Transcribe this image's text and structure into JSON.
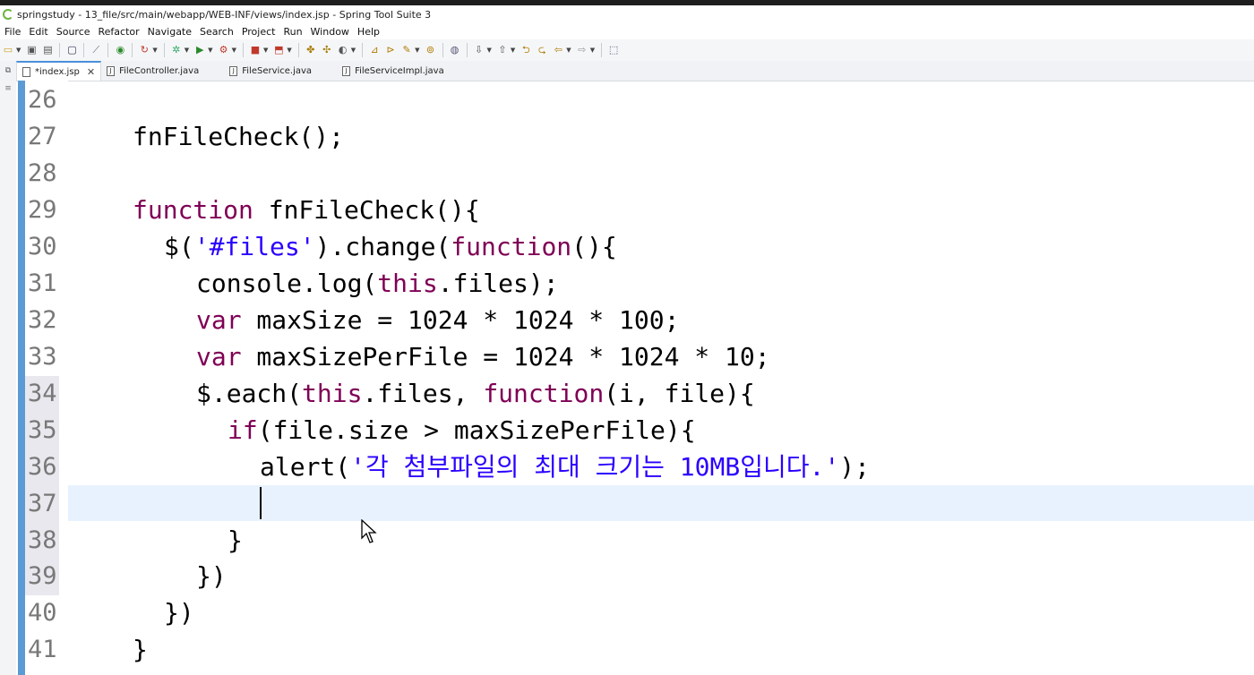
{
  "window": {
    "title": "springstudy - 13_file/src/main/webapp/WEB-INF/views/index.jsp - Spring Tool Suite 3"
  },
  "menu": [
    "File",
    "Edit",
    "Source",
    "Refactor",
    "Navigate",
    "Search",
    "Project",
    "Run",
    "Window",
    "Help"
  ],
  "tabs": [
    {
      "label": "*index.jsp",
      "active": true
    },
    {
      "label": "FileController.java",
      "active": false
    },
    {
      "label": "FileService.java",
      "active": false
    },
    {
      "label": "FileServiceImpl.java",
      "active": false
    }
  ],
  "editor": {
    "line_numbers": [
      "26",
      "27",
      "28",
      "29",
      "30",
      "31",
      "32",
      "33",
      "34",
      "35",
      "36",
      "37",
      "38",
      "39",
      "40",
      "41"
    ],
    "lines": {
      "l27": {
        "name": "fnFileCheck();"
      },
      "l29": {
        "kw": "function",
        "rest": " fnFileCheck(){"
      },
      "l30": {
        "a": "$(",
        "str": "'#files'",
        "b": ").change(",
        "kw": "function",
        "c": "(){"
      },
      "l31": {
        "a": "console.log(",
        "kw": "this",
        "b": ".files);"
      },
      "l32": {
        "kw": "var",
        "rest": " maxSize = 1024 * 1024 * 100;"
      },
      "l33": {
        "kw": "var",
        "rest": " maxSizePerFile = 1024 * 1024 * 10;"
      },
      "l34": {
        "a": "$.each(",
        "kw1": "this",
        "b": ".files, ",
        "kw2": "function",
        "c": "(i, file){"
      },
      "l35": {
        "kw": "if",
        "rest": "(file.size > maxSizePerFile){"
      },
      "l36": {
        "a": "alert(",
        "str": "'각 첨부파일의 최대 크기는 10MB입니다.'",
        "b": ");"
      },
      "l38": {
        "text": "}"
      },
      "l39": {
        "text": "})"
      },
      "l40": {
        "text": "})"
      },
      "l41": {
        "text": "}"
      }
    }
  },
  "colors": {
    "keyword": "#7f0055",
    "string": "#2a00ff",
    "current_line": "#e8f2fe",
    "change_bar": "#5b9bd5"
  }
}
